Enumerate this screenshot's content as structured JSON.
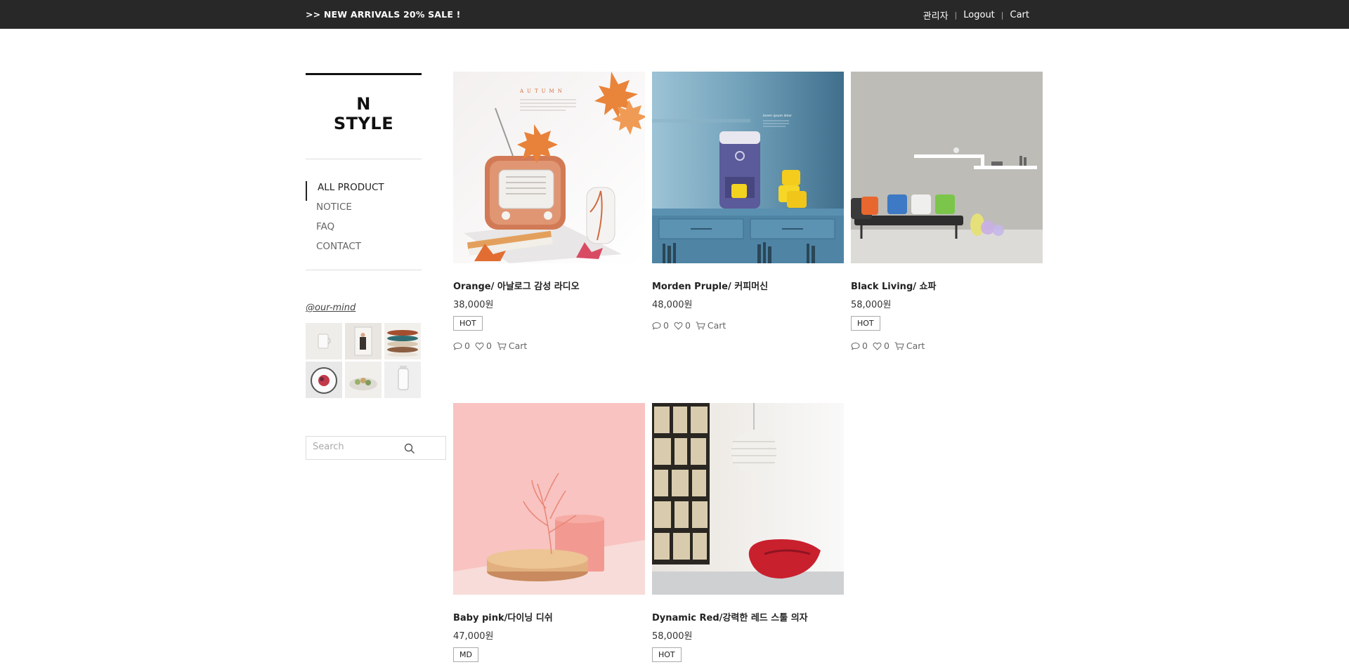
{
  "topbar": {
    "promo": ">> NEW ARRIVALS 20% SALE !",
    "links": [
      "관리자",
      "Logout",
      "Cart"
    ],
    "separator": "|"
  },
  "sidebar": {
    "logo_line1": "N",
    "logo_line2": "STYLE",
    "menu": [
      "ALL PRODUCT",
      "NOTICE",
      "FAQ",
      "CONTACT"
    ],
    "insta_handle": "@our-mind",
    "thumbnails": [
      "cup-photo",
      "poster-photo",
      "plates-photo",
      "dessert-plate-photo",
      "food-platter-photo",
      "kettle-photo"
    ],
    "search_placeholder": "Search",
    "search_icon": "search-icon"
  },
  "products": [
    {
      "name": "Orange/ 아날로그 감성 라디오",
      "price": "38,000원",
      "badge": "HOT",
      "comments": "0",
      "likes": "0",
      "cart": "Cart",
      "image": "autumn-radio"
    },
    {
      "name": "Morden Pruple/ 커피머신",
      "price": "48,000원",
      "badge": "",
      "comments": "0",
      "likes": "0",
      "cart": "Cart",
      "image": "coffee-machine"
    },
    {
      "name": "Black Living/ 쇼파",
      "price": "58,000원",
      "badge": "HOT",
      "comments": "0",
      "likes": "0",
      "cart": "Cart",
      "image": "living-sofa"
    },
    {
      "name": "Baby pink/다이닝 디쉬",
      "price": "47,000원",
      "badge": "MD",
      "comments": "",
      "likes": "",
      "cart": "",
      "image": "pink-dish"
    },
    {
      "name": "Dynamic Red/강력한 레드 스툴 의자",
      "price": "58,000원",
      "badge": "HOT",
      "comments": "",
      "likes": "",
      "cart": "",
      "image": "red-chair"
    }
  ],
  "colors": {
    "topbar": "#282828",
    "text": "#222222",
    "rule": "#dddddd"
  }
}
